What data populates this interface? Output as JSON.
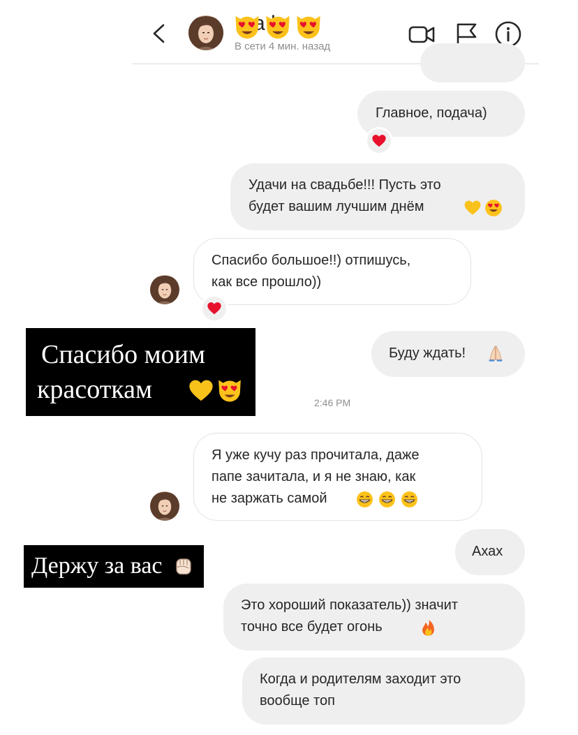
{
  "header": {
    "name": "a h",
    "status": "В сети 4 мин. назад"
  },
  "messages": [
    {
      "id": "m1",
      "direction": "out",
      "lines": [
        "Главное, подача)"
      ],
      "reaction": "red-heart"
    },
    {
      "id": "m2",
      "direction": "out",
      "lines": [
        "Удачи на свадьбе!!! Пусть это",
        "будет вашим лучшим днём"
      ],
      "emojis": [
        "yellow-heart",
        "heart-eyes"
      ]
    },
    {
      "id": "m3",
      "direction": "in",
      "lines": [
        "Спасибо большое!!) отпишусь,",
        "как все прошло))"
      ],
      "reaction": "red-heart"
    },
    {
      "id": "m4",
      "direction": "out",
      "lines": [
        "Буду ждать!"
      ],
      "emojis": [
        "folded-hands"
      ]
    },
    {
      "id": "m5",
      "direction": "in",
      "lines": [
        "Я уже кучу раз прочитала, даже",
        "папе зачитала, и я не знаю, как",
        "не заржать самой"
      ],
      "emojis": [
        "grin",
        "grin",
        "grin"
      ]
    },
    {
      "id": "m6",
      "direction": "out",
      "lines": [
        "Ахах"
      ]
    },
    {
      "id": "m7",
      "direction": "out",
      "lines": [
        "Это хороший показатель)) значит",
        "точно все будет огонь"
      ],
      "emojis": [
        "fire"
      ]
    },
    {
      "id": "m8",
      "direction": "out",
      "lines": [
        "Когда и родителям заходит это",
        "вообще топ"
      ]
    }
  ],
  "timestamp": "2:46 PM",
  "captions": [
    {
      "id": "c1",
      "lines": [
        "Спасибо моим",
        "красоткам"
      ],
      "emojis": [
        "yellow-heart",
        "heart-eyes-cat"
      ]
    },
    {
      "id": "c2",
      "lines": [
        "Держу за вас"
      ],
      "emojis": [
        "raised-fist"
      ]
    }
  ],
  "colors": {
    "outgoing_bubble": "#efefef",
    "incoming_border": "#e3e3e3",
    "caption_bg": "#000000",
    "caption_text": "#ffffff",
    "status_gray": "#8e8e8e"
  }
}
